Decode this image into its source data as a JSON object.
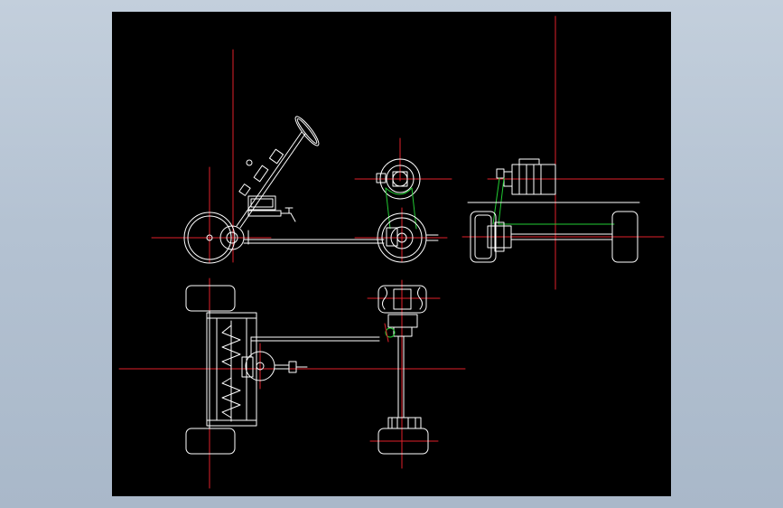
{
  "viewport": {
    "background": "#000000"
  },
  "colors": {
    "outline": "#ffffff",
    "centerline": "#e0202a",
    "belt": "#22cc33",
    "page_bg": "#b8c6d5"
  },
  "views": [
    "steering-side-view",
    "drive-end-view",
    "motor-side-view",
    "chassis-plan-view",
    "driveline-plan-view"
  ]
}
